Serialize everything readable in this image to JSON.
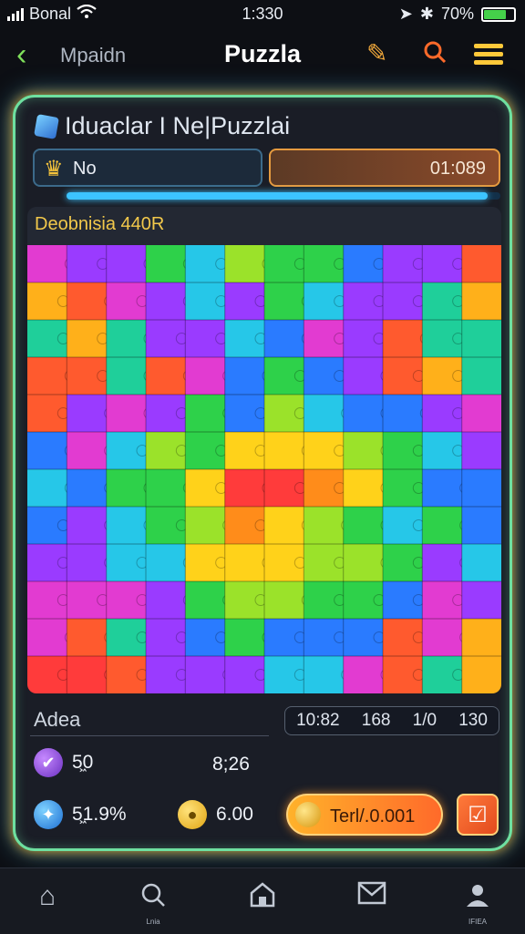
{
  "status_bar": {
    "carrier": "Bonal",
    "time": "1:330",
    "battery": "70%"
  },
  "appbar": {
    "back_label": "Mpaidn",
    "title": "Puzzla"
  },
  "panel": {
    "title": "Iduaclar I Ne|Puzzlai",
    "player_name": "No",
    "timer": "01:089",
    "progress": 0.97
  },
  "board": {
    "label": "Deobnisia 440R",
    "rows": 12,
    "cols": 12,
    "palette": [
      "#ff3b3b",
      "#ff8c1a",
      "#ffd21a",
      "#9be22a",
      "#2ed14a",
      "#26c7e8",
      "#2a7bff",
      "#9a3bff",
      "#e23bd1",
      "#ff5a2e",
      "#1fcf9a",
      "#ffb01a"
    ]
  },
  "stats": {
    "area_label": "Adea",
    "values": [
      "10:82",
      "168",
      "1/0",
      "130"
    ]
  },
  "rows": {
    "item1": {
      "value": "5͖0",
      "value2": "8;26"
    },
    "item2": {
      "value": "5͖1.9%",
      "value2": "6.00"
    }
  },
  "cta": {
    "label": "Terl/.0.001"
  },
  "bottom_nav": {
    "items": [
      {
        "icon": "home-icon"
      },
      {
        "icon": "search-icon",
        "caption": "Lnia"
      },
      {
        "icon": "store-icon"
      },
      {
        "icon": "mail-icon"
      },
      {
        "icon": "profile-icon",
        "caption": "IFIEA"
      }
    ]
  },
  "colors": {
    "neon_border": "#6ee0a0",
    "accent_orange": "#ff8a2a",
    "accent_blue": "#3cc4ff"
  }
}
